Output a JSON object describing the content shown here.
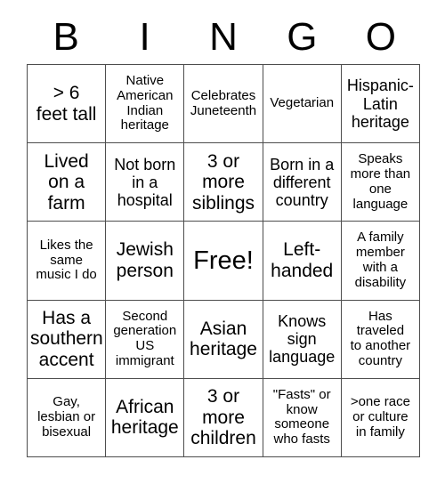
{
  "card": {
    "header_letters": [
      "B",
      "I",
      "N",
      "G",
      "O"
    ],
    "columns": 5,
    "rows": 5,
    "border_color": "#4d4d4d",
    "text_color": "#000000",
    "background_color": "#ffffff",
    "cells": [
      {
        "text": "> 6\nfeet tall",
        "size": "xl",
        "free_space": false
      },
      {
        "text": "Native\nAmerican\nIndian\nheritage",
        "size": "md",
        "free_space": false
      },
      {
        "text": "Celebrates\nJuneteenth",
        "size": "md",
        "free_space": false
      },
      {
        "text": "Vegetarian",
        "size": "md",
        "free_space": false
      },
      {
        "text": "Hispanic-\nLatin\nheritage",
        "size": "lg",
        "free_space": false
      },
      {
        "text": "Lived\non a\nfarm",
        "size": "xl",
        "free_space": false
      },
      {
        "text": "Not born\nin a\nhospital",
        "size": "lg",
        "free_space": false
      },
      {
        "text": "3 or\nmore\nsiblings",
        "size": "xl",
        "free_space": false
      },
      {
        "text": "Born in a\ndifferent\ncountry",
        "size": "lg",
        "free_space": false
      },
      {
        "text": "Speaks\nmore than\none\nlanguage",
        "size": "md",
        "free_space": false
      },
      {
        "text": "Likes the\nsame\nmusic I do",
        "size": "md",
        "free_space": false
      },
      {
        "text": "Jewish\nperson",
        "size": "xl",
        "free_space": false
      },
      {
        "text": "Free!",
        "size": "xxl",
        "free_space": true
      },
      {
        "text": "Left-\nhanded",
        "size": "xl",
        "free_space": false
      },
      {
        "text": "A family\nmember\nwith a\ndisability",
        "size": "md",
        "free_space": false
      },
      {
        "text": "Has a\nsouthern\naccent",
        "size": "xl",
        "free_space": false
      },
      {
        "text": "Second\ngeneration\nUS\nimmigrant",
        "size": "md",
        "free_space": false
      },
      {
        "text": "Asian\nheritage",
        "size": "xl",
        "free_space": false
      },
      {
        "text": "Knows\nsign\nlanguage",
        "size": "lg",
        "free_space": false
      },
      {
        "text": "Has\ntraveled\nto another\ncountry",
        "size": "md",
        "free_space": false
      },
      {
        "text": "Gay,\nlesbian or\nbisexual",
        "size": "md",
        "free_space": false
      },
      {
        "text": "African\nheritage",
        "size": "xl",
        "free_space": false
      },
      {
        "text": "3 or\nmore\nchildren",
        "size": "xl",
        "free_space": false
      },
      {
        "text": "\"Fasts\" or\nknow\nsomeone\nwho fasts",
        "size": "md",
        "free_space": false
      },
      {
        "text": ">one race\nor culture\nin family",
        "size": "md",
        "free_space": false
      }
    ]
  }
}
